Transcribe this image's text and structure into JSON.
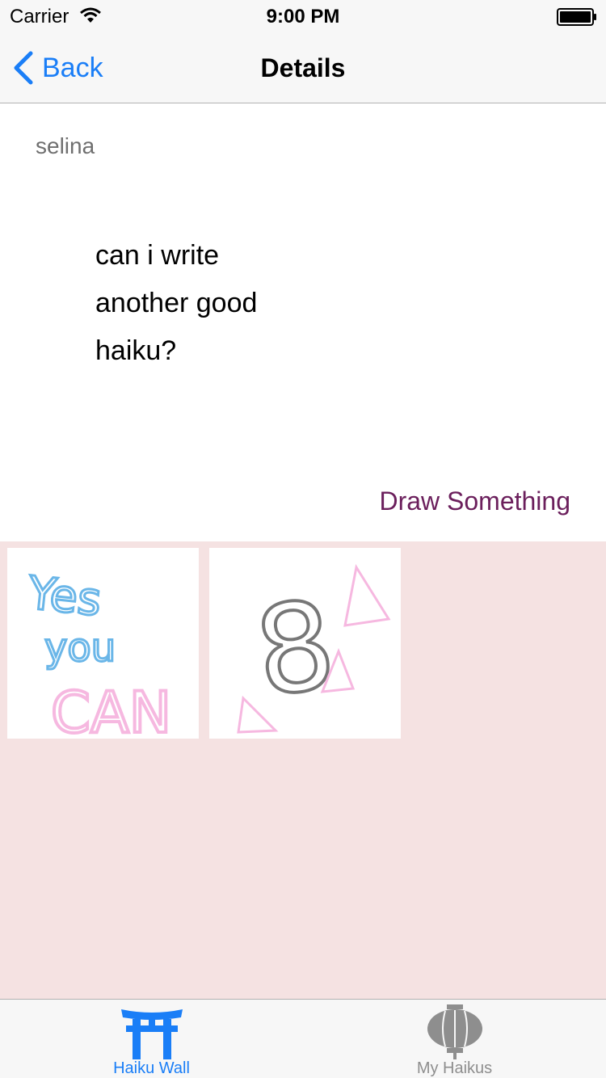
{
  "status_bar": {
    "carrier": "Carrier",
    "time": "9:00 PM"
  },
  "nav": {
    "back_label": "Back",
    "title": "Details"
  },
  "post": {
    "author": "selina",
    "haiku_lines": [
      "can i write",
      "another good",
      "haiku?"
    ],
    "draw_button_label": "Draw Something"
  },
  "drawings": [
    {
      "text_lines": [
        "Yes",
        "you",
        "CAN"
      ]
    },
    {
      "text_lines": [
        "8"
      ]
    }
  ],
  "tabs": [
    {
      "label": "Haiku Wall",
      "icon": "torii-gate-icon",
      "active": true
    },
    {
      "label": "My Haikus",
      "icon": "lantern-icon",
      "active": false
    }
  ],
  "colors": {
    "accent": "#1a7ef7",
    "draw_button": "#6b1f5c",
    "drawings_background": "#f5e2e2",
    "pink_ink": "#f6b8e0",
    "blue_ink": "#6ab6e8",
    "gray_ink": "#777777"
  }
}
